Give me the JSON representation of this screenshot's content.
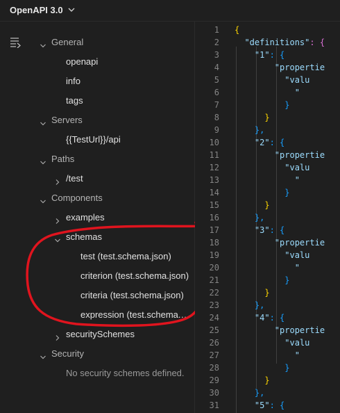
{
  "toolbar": {
    "title": "OpenAPI 3.0",
    "dropdown_icon": "chevron-down-icon"
  },
  "sidebar": {
    "outline_icon": "list-outline-icon",
    "general": {
      "label": "General",
      "items": [
        "openapi",
        "info",
        "tags"
      ]
    },
    "servers": {
      "label": "Servers",
      "items": [
        "{{TestUrl}}/api"
      ]
    },
    "paths": {
      "label": "Paths",
      "items": [
        "/test"
      ]
    },
    "components": {
      "label": "Components",
      "examples": "examples",
      "schemas": "schemas",
      "schema_items": [
        "test (test.schema.json)",
        "criterion (test.schema.json)",
        "criteria (test.schema.json)",
        "expression (test.schema.json)"
      ],
      "security_schemes": "securitySchemes"
    },
    "security": {
      "label": "Security",
      "empty_message": "No security schemes defined."
    },
    "annotation_color": "#e0141e"
  },
  "editor": {
    "line_numbers": [
      "1",
      "2",
      "3",
      "4",
      "5",
      "6",
      "7",
      "8",
      "9",
      "10",
      "11",
      "12",
      "13",
      "14",
      "15",
      "16",
      "17",
      "18",
      "19",
      "20",
      "21",
      "22",
      "23",
      "24",
      "25",
      "26",
      "27",
      "28",
      "29",
      "30",
      "31"
    ],
    "tokens": {
      "open_brace": "{",
      "close_brace": "}",
      "close_brace_comma": "},",
      "colon_brace": ": {",
      "definitions_key": "\"definitions\"",
      "def_keys": [
        "\"1\"",
        "\"2\"",
        "\"3\"",
        "\"4\"",
        "\"5\""
      ],
      "properties_key": "\"propertie",
      "value_key": "\"valu",
      "quote_fragment": "\""
    },
    "colors": {
      "background": "#1f1f1f",
      "line_number": "#858585",
      "key": "#9cdcfe",
      "bracket_level_1": "#ffd700",
      "bracket_level_2": "#da70d6",
      "bracket_level_3": "#179fff"
    }
  }
}
